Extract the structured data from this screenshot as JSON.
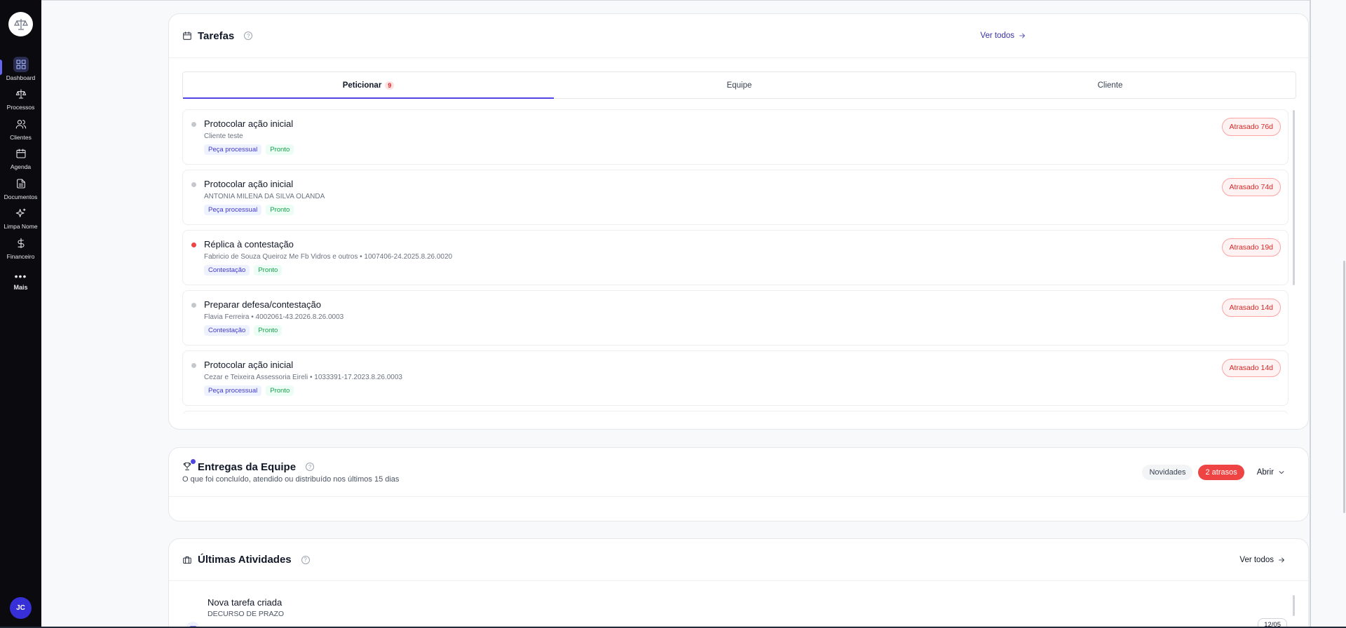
{
  "sidebar": {
    "logo_icon": "scales-logo-icon",
    "items": [
      {
        "label": "Dashboard",
        "icon": "grid-icon",
        "active": true
      },
      {
        "label": "Processos",
        "icon": "scales-icon"
      },
      {
        "label": "Clientes",
        "icon": "users-icon"
      },
      {
        "label": "Agenda",
        "icon": "calendar-icon"
      },
      {
        "label": "Documentos",
        "icon": "document-icon"
      },
      {
        "label": "Limpa Nome",
        "icon": "sparkles-icon"
      },
      {
        "label": "Financeiro",
        "icon": "dollar-icon"
      }
    ],
    "more_label": "Mais",
    "avatar_initials": "JC"
  },
  "tarefas": {
    "title": "Tarefas",
    "view_all": "Ver todos",
    "tabs": [
      {
        "label": "Peticionar",
        "badge": "9",
        "active": true
      },
      {
        "label": "Equipe"
      },
      {
        "label": "Cliente"
      }
    ],
    "tasks": [
      {
        "title": "Protocolar ação inicial",
        "subtitle": "Cliente teste",
        "tags": [
          "Peça processual",
          "Pronto"
        ],
        "status": "Atrasado 76d",
        "dot": "grey"
      },
      {
        "title": "Protocolar ação inicial",
        "subtitle": "ANTONIA MILENA DA SILVA OLANDA",
        "tags": [
          "Peça processual",
          "Pronto"
        ],
        "status": "Atrasado 74d",
        "dot": "grey"
      },
      {
        "title": "Réplica à contestação",
        "subtitle": "Fabricio de Souza Queiroz Me Fb Vidros e outros • 1007406-24.2025.8.26.0020",
        "tags": [
          "Contestação",
          "Pronto"
        ],
        "status": "Atrasado 19d",
        "dot": "red"
      },
      {
        "title": "Preparar defesa/contestação",
        "subtitle": "Flavia Ferreira • 4002061-43.2026.8.26.0003",
        "tags": [
          "Contestação",
          "Pronto"
        ],
        "status": "Atrasado 14d",
        "dot": "grey"
      },
      {
        "title": "Protocolar ação inicial",
        "subtitle": "Cezar e Teixeira Assessoria Eireli • 1033391-17.2023.8.26.0003",
        "tags": [
          "Peça processual",
          "Pronto"
        ],
        "status": "Atrasado 14d",
        "dot": "grey"
      }
    ]
  },
  "entregas": {
    "title": "Entregas da Equipe",
    "subtitle": "O que foi concluído, atendido ou distribuído nos últimos 15 dias",
    "novidades": "Novidades",
    "atrasos": "2 atrasos",
    "abrir": "Abrir"
  },
  "atividades": {
    "title": "Últimas Atividades",
    "view_all": "Ver todos",
    "items": [
      {
        "title": "Nova tarefa criada",
        "subtitle": "DECURSO DE PRAZO",
        "date": "12/05"
      }
    ]
  },
  "colors": {
    "accent": "#4f46e5",
    "danger": "#ef4444",
    "sidebar": "#0b0b0f"
  }
}
